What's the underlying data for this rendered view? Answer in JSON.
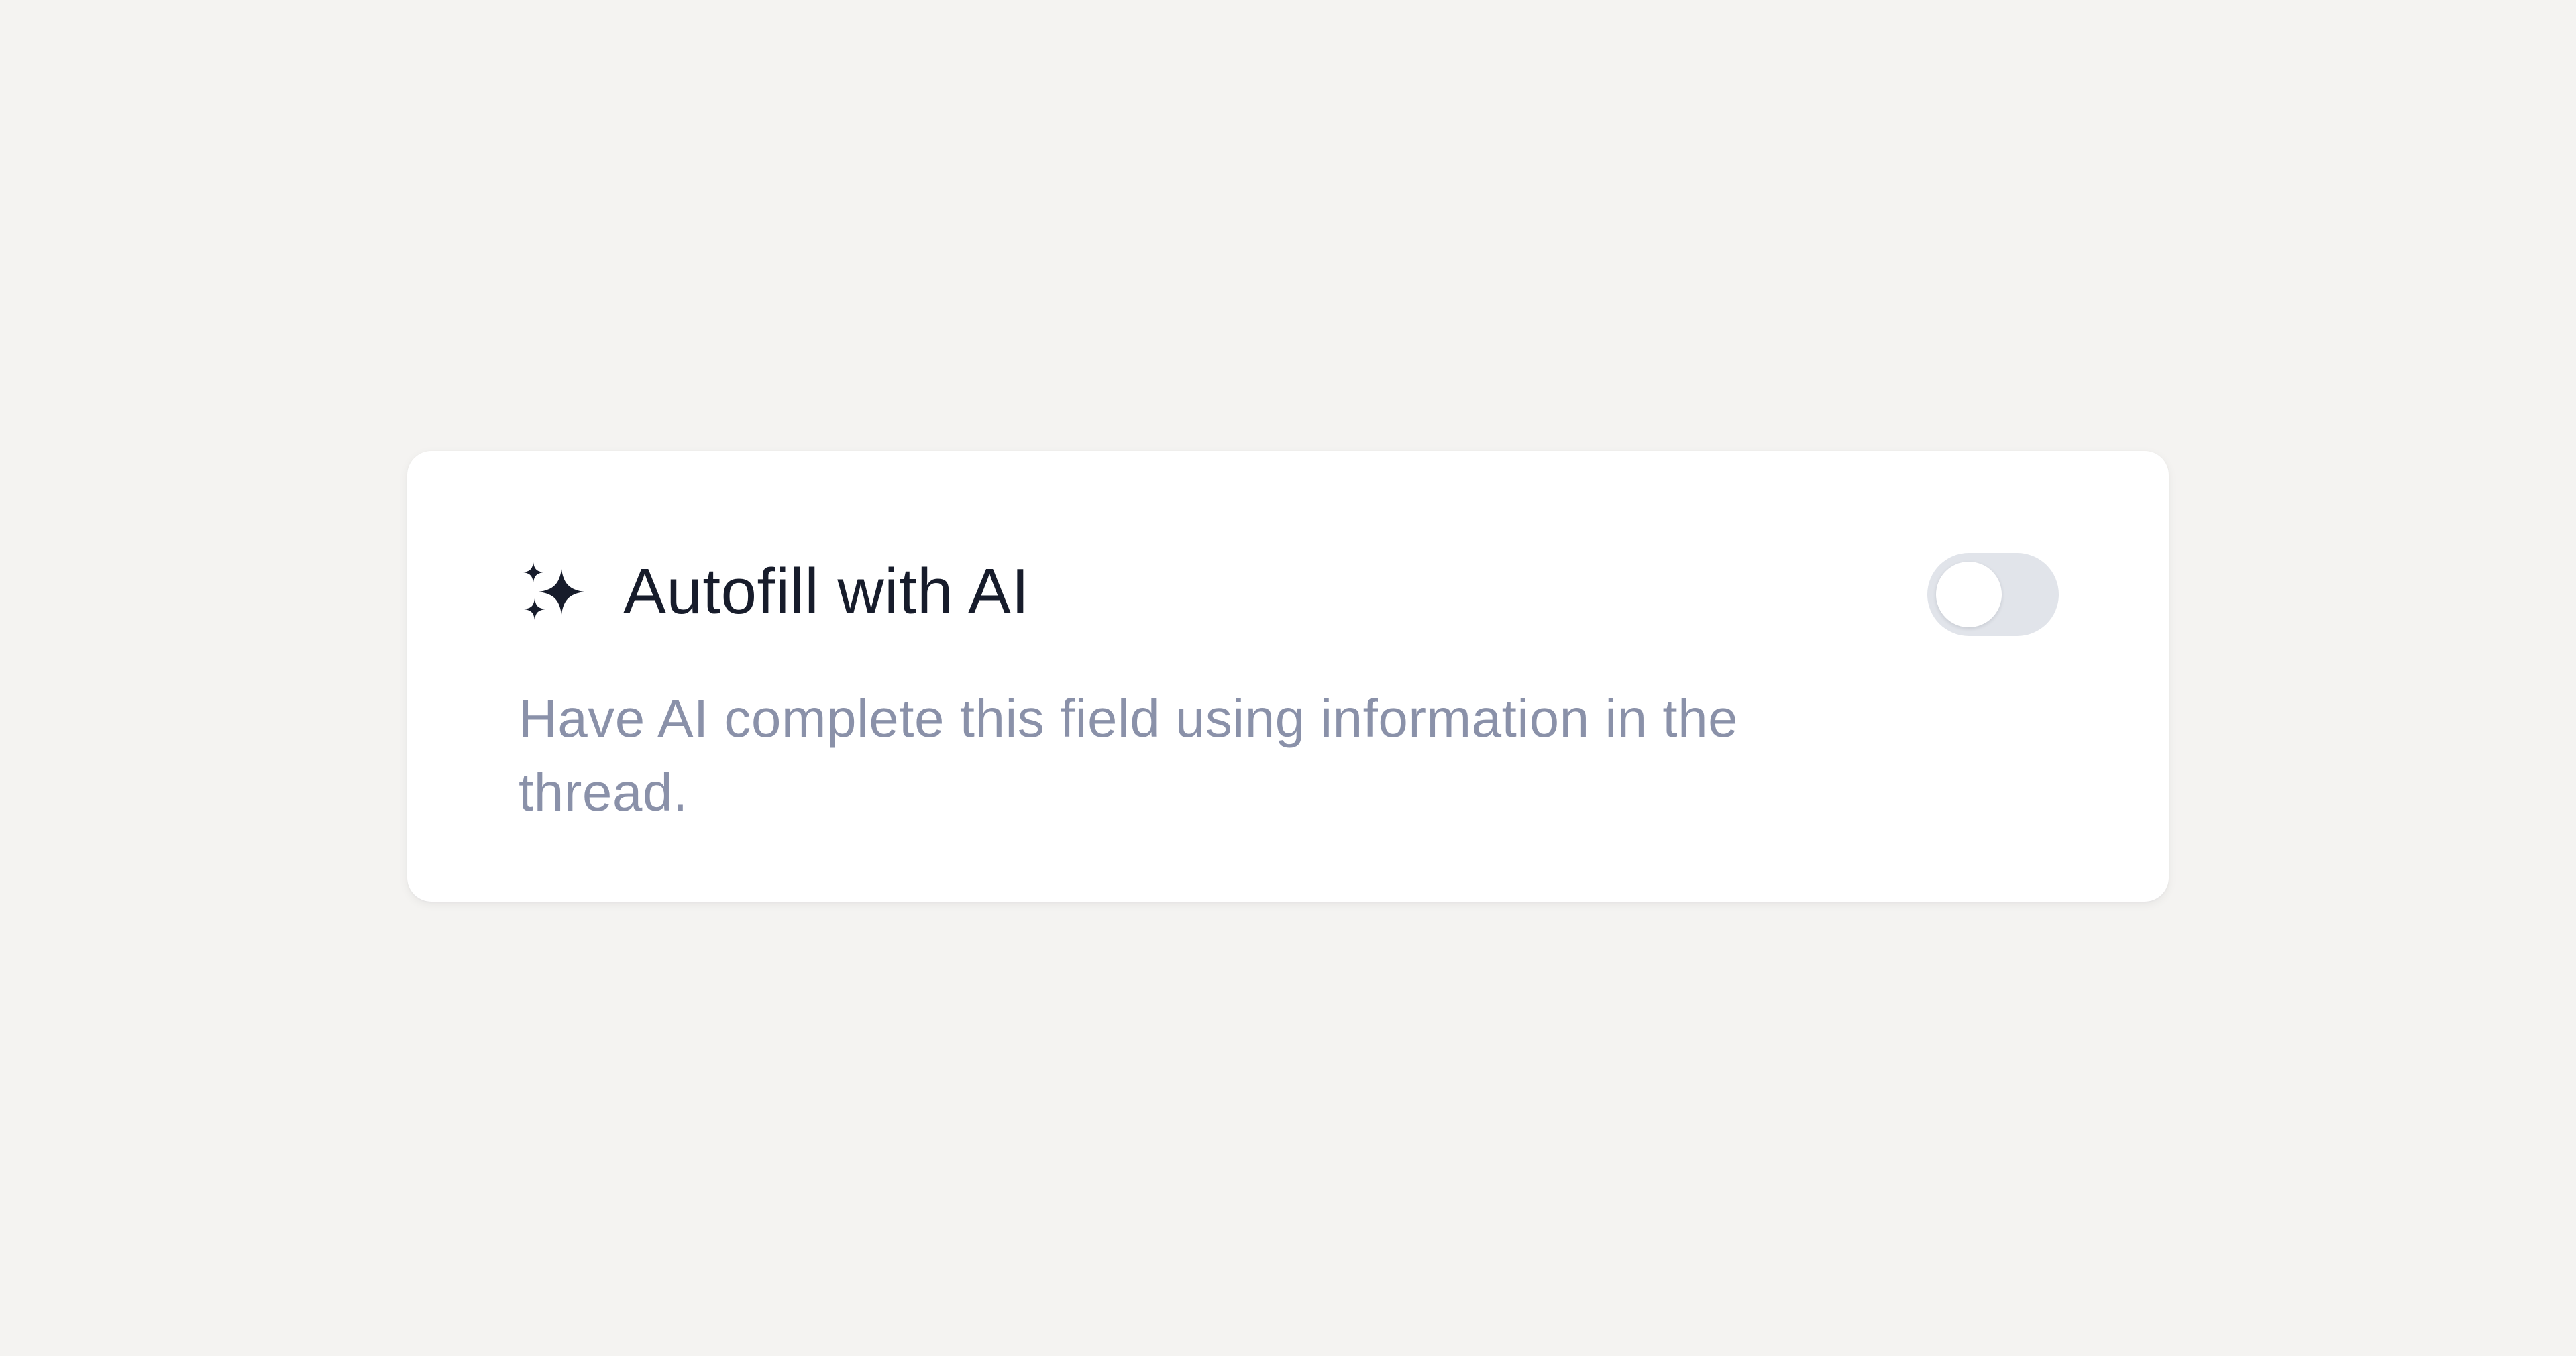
{
  "setting": {
    "icon": "sparkles-icon",
    "title": "Autofill with AI",
    "description": "Have AI complete this field using information in the thread.",
    "toggle": {
      "enabled": false
    }
  },
  "colors": {
    "background": "#f4f3f1",
    "card": "#ffffff",
    "title": "#171c2b",
    "description": "#8a91a9",
    "toggle_off_track": "#e1e4ea",
    "toggle_knob": "#ffffff"
  }
}
